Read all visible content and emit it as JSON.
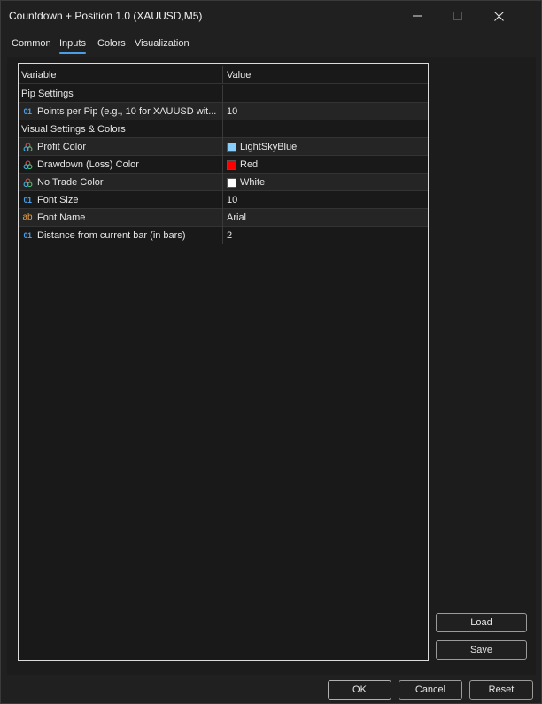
{
  "window": {
    "title": "Countdown + Position 1.0 (XAUUSD,M5)"
  },
  "tabs": [
    {
      "label": "Common",
      "active": false
    },
    {
      "label": "Inputs",
      "active": true
    },
    {
      "label": "Colors",
      "active": false
    },
    {
      "label": "Visualization",
      "active": false
    }
  ],
  "grid": {
    "headers": {
      "variable": "Variable",
      "value": "Value"
    },
    "rows": [
      {
        "type": "group",
        "variable": "Pip Settings",
        "value": ""
      },
      {
        "type": "number",
        "icon": "number-icon",
        "icon_text": "01",
        "variable": "Points per Pip (e.g., 10 for XAUUSD wit...",
        "value": "10"
      },
      {
        "type": "group",
        "variable": "Visual Settings & Colors",
        "value": ""
      },
      {
        "type": "color",
        "icon": "color-icon",
        "variable": "Profit Color",
        "value": "LightSkyBlue",
        "swatch": "#87cefa"
      },
      {
        "type": "color",
        "icon": "color-icon",
        "variable": "Drawdown (Loss) Color",
        "value": "Red",
        "swatch": "#ff0000"
      },
      {
        "type": "color",
        "icon": "color-icon",
        "variable": "No Trade Color",
        "value": "White",
        "swatch": "#ffffff"
      },
      {
        "type": "number",
        "icon": "number-icon",
        "icon_text": "01",
        "variable": "Font Size",
        "value": "10"
      },
      {
        "type": "string",
        "icon": "string-icon",
        "icon_text": "ab",
        "variable": "Font Name",
        "value": "Arial"
      },
      {
        "type": "number",
        "icon": "number-icon",
        "icon_text": "01",
        "variable": "Distance from current bar (in bars)",
        "value": "2"
      }
    ]
  },
  "buttons": {
    "load": "Load",
    "save": "Save",
    "ok": "OK",
    "cancel": "Cancel",
    "reset": "Reset"
  },
  "colors": {
    "accent": "#4a9ee8",
    "string_icon": "#e8a043"
  }
}
